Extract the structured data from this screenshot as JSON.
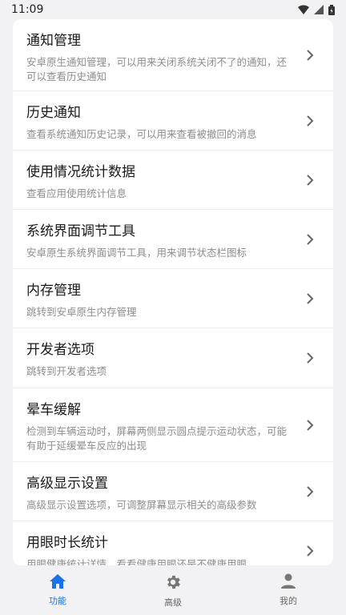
{
  "status": {
    "time": "11:09"
  },
  "items": [
    {
      "title": "通知管理",
      "desc": "安卓原生通知管理，可以用来关闭系统关闭不了的通知，还可以查看历史通知"
    },
    {
      "title": "历史通知",
      "desc": "查看系统通知历史记录，可以用来查看被撤回的消息"
    },
    {
      "title": "使用情况统计数据",
      "desc": "查看应用使用统计信息"
    },
    {
      "title": "系统界面调节工具",
      "desc": "安卓原生系统界面调节工具，用来调节状态栏图标"
    },
    {
      "title": "内存管理",
      "desc": "跳转到安卓原生内存管理"
    },
    {
      "title": "开发者选项",
      "desc": "跳转到开发者选项"
    },
    {
      "title": "晕车缓解",
      "desc": "检测到车辆运动时，屏幕两侧显示圆点提示运动状态，可能有助于延缓晕车反应的出现"
    },
    {
      "title": "高级显示设置",
      "desc": "高级显示设置选项，可调整屏幕显示相关的高级参数"
    },
    {
      "title": "用眼时长统计",
      "desc": "用眼健康统计详情，看看健康用眼还是不健康用眼"
    }
  ],
  "nav": [
    {
      "label": "功能",
      "icon": "home-icon",
      "active": true
    },
    {
      "label": "高级",
      "icon": "gear-icon",
      "active": false
    },
    {
      "label": "我的",
      "icon": "person-icon",
      "active": false
    }
  ],
  "colors": {
    "accent": "#1a73e8",
    "background": "#f2f2f4",
    "card": "#ffffff"
  }
}
